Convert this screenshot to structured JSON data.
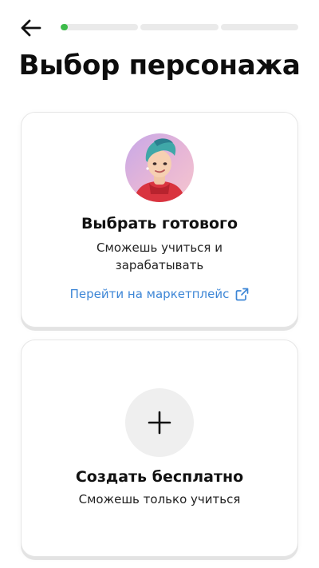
{
  "header": {
    "back_icon": "arrow-left-icon",
    "progress": {
      "segments": 3,
      "current_fraction": 0.03,
      "accent": "#3dbb4a"
    }
  },
  "title": "Выбор персонажа",
  "cards": {
    "ready": {
      "avatar_icon": "character-avatar",
      "title": "Выбрать готового",
      "description": "Сможешь учиться и зарабатывать",
      "link_label": "Перейти на маркетплейс",
      "link_icon": "external-link-icon",
      "link_color": "#3d86d6"
    },
    "create": {
      "icon": "plus-icon",
      "title": "Создать бесплатно",
      "description": "Сможешь только учиться"
    }
  }
}
